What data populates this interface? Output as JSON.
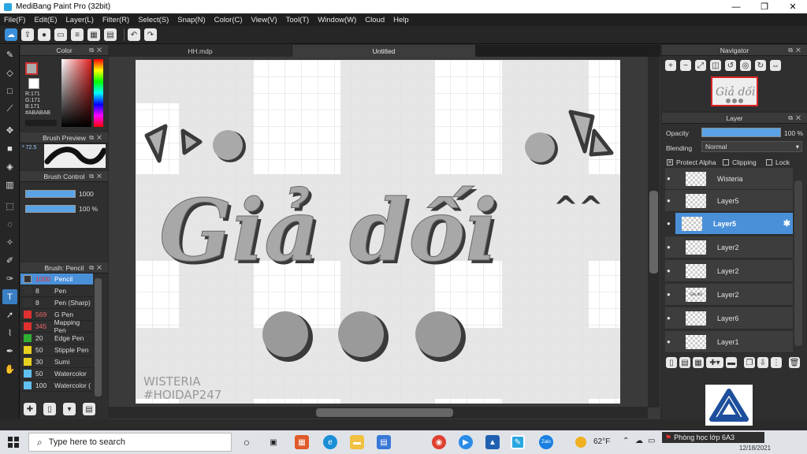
{
  "window": {
    "title": "MediBang Paint Pro (32bit)",
    "minimize": "—",
    "maximize": "❐",
    "close": "✕"
  },
  "menu": [
    "File(F)",
    "Edit(E)",
    "Layer(L)",
    "Filter(R)",
    "Select(S)",
    "Snap(N)",
    "Color(C)",
    "View(V)",
    "Tool(T)",
    "Window(W)",
    "Cloud",
    "Help"
  ],
  "toolbar": {
    "icons": [
      "cloud-icon",
      "share-icon",
      "chat-icon",
      "comment-icon",
      "document-icon",
      "grid-doc-icon",
      "layout-icon",
      "undo-icon",
      "redo-icon"
    ]
  },
  "left_tools": [
    "brush-icon",
    "eraser-icon",
    "rectangle-icon",
    "pen-icon",
    "move-icon",
    "fill-rect-icon",
    "bucket-icon",
    "gradient-icon",
    "select-rect-icon",
    "lasso-icon",
    "magic-wand-icon",
    "select-pen-icon",
    "select-eraser-icon",
    "text-icon",
    "operation-icon",
    "eyedropper-icon",
    "pen-tool-icon",
    "hand-icon"
  ],
  "color_panel": {
    "title": "Color",
    "r": "R:171",
    "g": "G:171",
    "b": "B:171",
    "hex": "#ABABAB"
  },
  "brush_preview": {
    "title": "Brush Preview",
    "size": "* 72.5"
  },
  "brush_control": {
    "title": "Brush Control",
    "size_value": "1000",
    "opacity_value": "100 %"
  },
  "brush_list": {
    "title": "Brush: Pencil",
    "items": [
      {
        "size": "1000",
        "name": "Pencil",
        "color": "#333333",
        "selected": true
      },
      {
        "size": "8",
        "name": "Pen",
        "color": "#333333"
      },
      {
        "size": "8",
        "name": "Pen (Sharp)",
        "color": "#333333"
      },
      {
        "size": "569",
        "name": "G Pen",
        "color": "#e03030"
      },
      {
        "size": "345",
        "name": "Mapping Pen",
        "color": "#e03030"
      },
      {
        "size": "20",
        "name": "Edge Pen",
        "color": "#30b030"
      },
      {
        "size": "50",
        "name": "Stipple Pen",
        "color": "#e8d020"
      },
      {
        "size": "30",
        "name": "Sumi",
        "color": "#e8d020"
      },
      {
        "size": "50",
        "name": "Watercolor",
        "color": "#60c0f0"
      },
      {
        "size": "100",
        "name": "Watercolor (",
        "color": "#60c0f0"
      }
    ]
  },
  "tabs": [
    "HH.mdp",
    "Untitled"
  ],
  "canvas": {
    "main_text": "Giả dối",
    "caret": "^^",
    "watermark_1": "WISTERIA",
    "watermark_2": "#HOIDAP247"
  },
  "navigator": {
    "title": "Navigator"
  },
  "layer_panel": {
    "title": "Layer",
    "opacity_label": "Opacity",
    "opacity_value": "100 %",
    "opacity": 1.0,
    "blending_label": "Blending",
    "blending_value": "Normal",
    "protect_alpha": "Protect Alpha",
    "clipping": "Clipping",
    "lock": "Lock",
    "layers": [
      {
        "name": "Wisteria",
        "thumb": "wisteria"
      },
      {
        "name": "Layer5",
        "thumb": ""
      },
      {
        "name": "Layer5",
        "thumb": "",
        "selected": true
      },
      {
        "name": "Layer2",
        "thumb": ""
      },
      {
        "name": "Layer2",
        "thumb": ""
      },
      {
        "name": "Layer2",
        "thumb": "Giả dối"
      },
      {
        "name": "Layer6",
        "thumb": ""
      },
      {
        "name": "Layer1",
        "thumb": ""
      }
    ]
  },
  "taskbar": {
    "search_placeholder": "Type here to search",
    "weather": "62°F",
    "notification": "Phòng học lớp 6A3",
    "date": "12/18/2021",
    "zalo": "Zalo"
  }
}
